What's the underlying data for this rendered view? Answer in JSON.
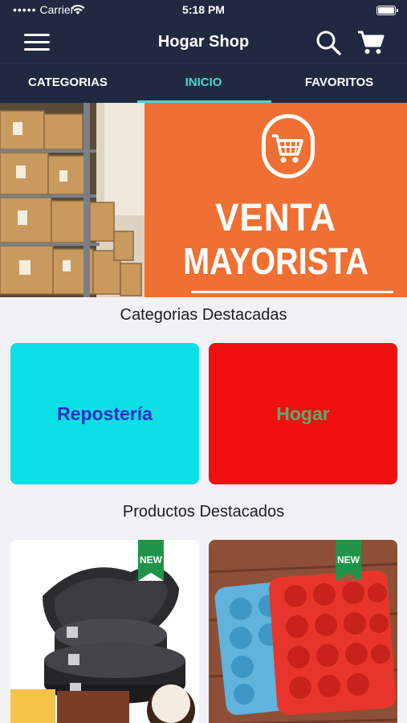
{
  "status_bar": {
    "carrier": "Carrier",
    "time": "5:18 PM"
  },
  "navbar": {
    "title": "Hogar Shop"
  },
  "tabs": [
    {
      "label": "CATEGORIAS",
      "active": false
    },
    {
      "label": "INICIO",
      "active": true
    },
    {
      "label": "FAVORITOS",
      "active": false
    }
  ],
  "banner": {
    "line1": "VENTA",
    "line2": "MAYORISTA"
  },
  "featured_categories": {
    "title": "Categorias Destacadas",
    "items": [
      {
        "label": "Repostería",
        "bg": "#0adfe6",
        "color": "#2a2fc6"
      },
      {
        "label": "Hogar",
        "bg": "#f0100f",
        "color": "#5fa86b"
      }
    ]
  },
  "featured_products": {
    "title": "Productos Destacados",
    "items": [
      {
        "badge": "NEW"
      },
      {
        "badge": "NEW"
      }
    ]
  },
  "colors": {
    "header": "#20293f",
    "accent": "#45d8d6",
    "banner_orange": "#ef7032",
    "badge_green": "#1f9448"
  }
}
